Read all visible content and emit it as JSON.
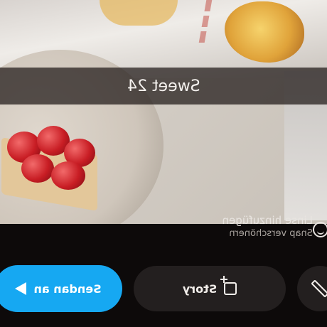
{
  "caption": {
    "text": "Sweet 24"
  },
  "lens_hint": {
    "title": "Linse hinzufügen",
    "subtitle": "Snap verschönern"
  },
  "actions": {
    "send_label": "Sendan an",
    "story_label": "Story"
  },
  "icons": {
    "smiley": "smiley-icon",
    "send": "send-arrow-icon",
    "story": "add-story-icon",
    "edit": "pencil-icon"
  },
  "colors": {
    "send_button": "#16a8f2",
    "dark_button": "#231f1f",
    "background": "#0d0a0a"
  }
}
